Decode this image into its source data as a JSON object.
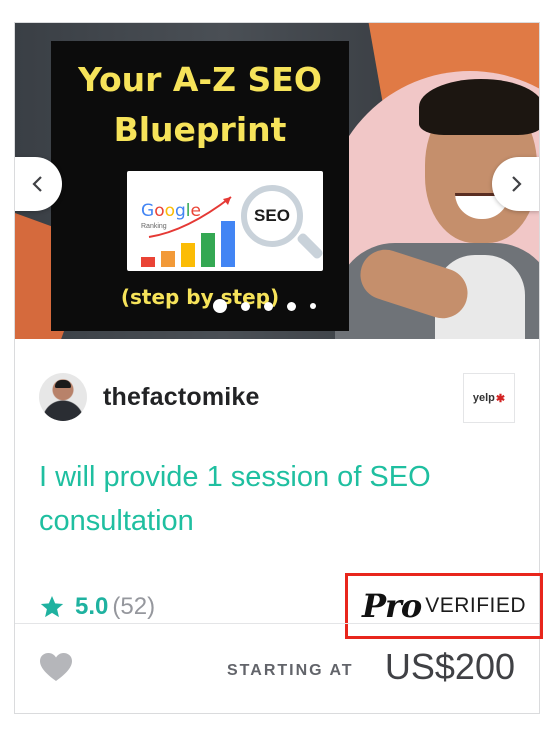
{
  "hero": {
    "title_line1": "Your A-Z SEO",
    "title_line2": "Blueprint",
    "subtitle": "(step by step)",
    "google_letters": [
      "G",
      "o",
      "o",
      "g",
      "l",
      "e"
    ],
    "ranking_text": "Ranking",
    "seo_text": "SEO",
    "slide_count": 5,
    "active_slide": 1
  },
  "seller": {
    "name": "thefactomike",
    "partner_badge": "yelp",
    "partner_badge_burst": "✱"
  },
  "gig": {
    "title": "I will provide 1 session of SEO consultation"
  },
  "rating": {
    "value": "5.0",
    "count": "(52)"
  },
  "pro": {
    "pro_text": "Pro",
    "verified_text": "VERIFIED"
  },
  "footer": {
    "starting_label": "STARTING AT",
    "price": "US$200"
  },
  "colors": {
    "accent_teal": "#1fbfa0",
    "star_teal": "#1fb2a0",
    "highlight_red": "#e8261c",
    "heart_gray": "#b5b6ba"
  },
  "icons": {
    "prev": "chevron-left-icon",
    "next": "chevron-right-icon",
    "star": "star-icon",
    "favorite": "heart-icon"
  }
}
